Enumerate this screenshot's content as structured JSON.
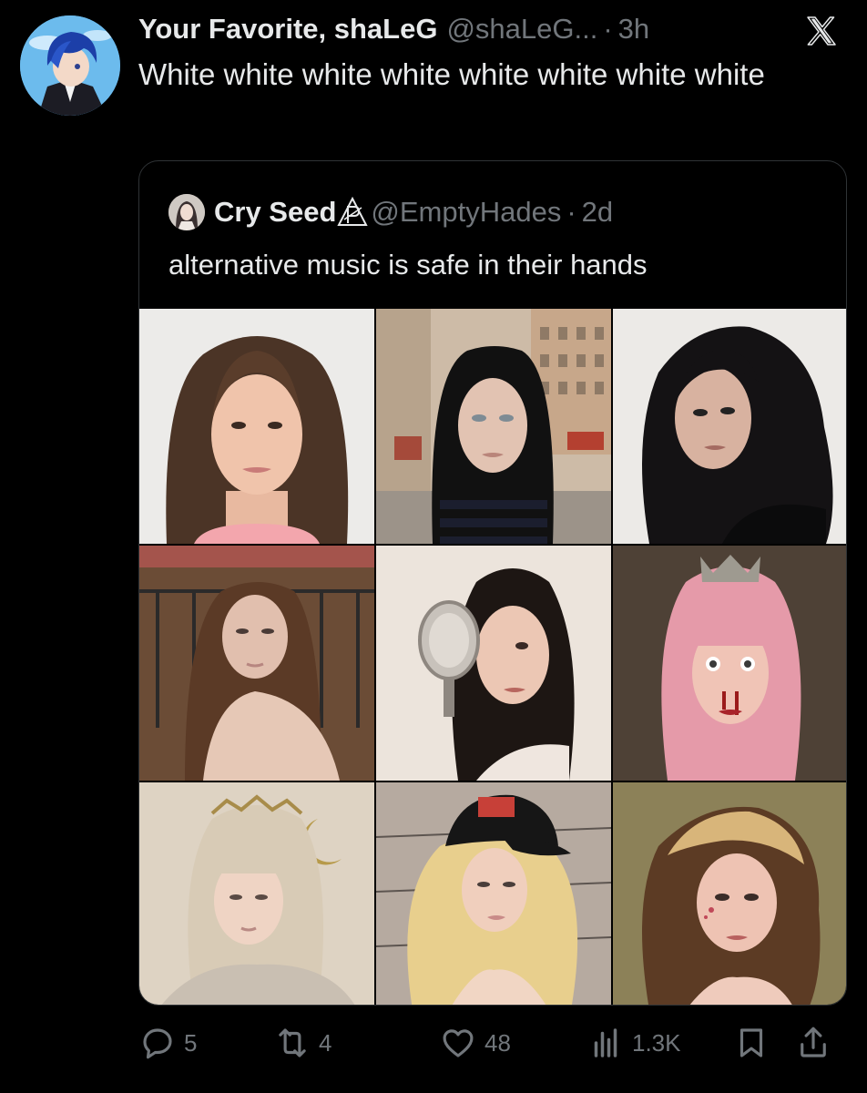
{
  "post": {
    "display_name": "Your Favorite, shaLeG",
    "handle": "@shaLeG...",
    "separator": "·",
    "time": "3h",
    "text": "White white white white white white white white"
  },
  "quoted": {
    "display_name": "Cry Seed",
    "handle": "@EmptyHades",
    "separator": "·",
    "time": "2d",
    "text": "alternative music is safe in their hands"
  },
  "actions": {
    "replies": "5",
    "reposts": "4",
    "likes": "48",
    "views": "1.3K"
  },
  "icons": [
    "avatar",
    "x-logo-icon",
    "reply-icon",
    "repost-icon",
    "like-icon",
    "views-icon",
    "bookmark-icon",
    "share-icon"
  ],
  "colors": {
    "background": "#000000",
    "text_primary": "#e7e9ea",
    "text_secondary": "#71767b",
    "border": "#2f3336"
  }
}
